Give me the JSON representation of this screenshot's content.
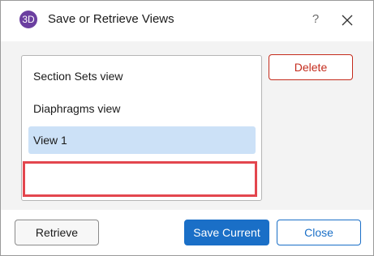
{
  "window": {
    "title": "Save or Retrieve Views",
    "app_icon": "3D",
    "help_label": "?",
    "close_icon": "close-icon"
  },
  "views_list": {
    "items": [
      {
        "label": "Section Sets view",
        "selected": false
      },
      {
        "label": "Diaphragms view",
        "selected": false
      },
      {
        "label": "View 1",
        "selected": true
      }
    ]
  },
  "actions": {
    "delete_label": "Delete",
    "retrieve_label": "Retrieve",
    "save_current_label": "Save Current",
    "close_label": "Close"
  },
  "colors": {
    "primary": "#1a6fc7",
    "delete": "#c42b1c",
    "selection": "#cce1f7",
    "highlight": "#e3464e",
    "app_icon": "#6b3fa0"
  }
}
